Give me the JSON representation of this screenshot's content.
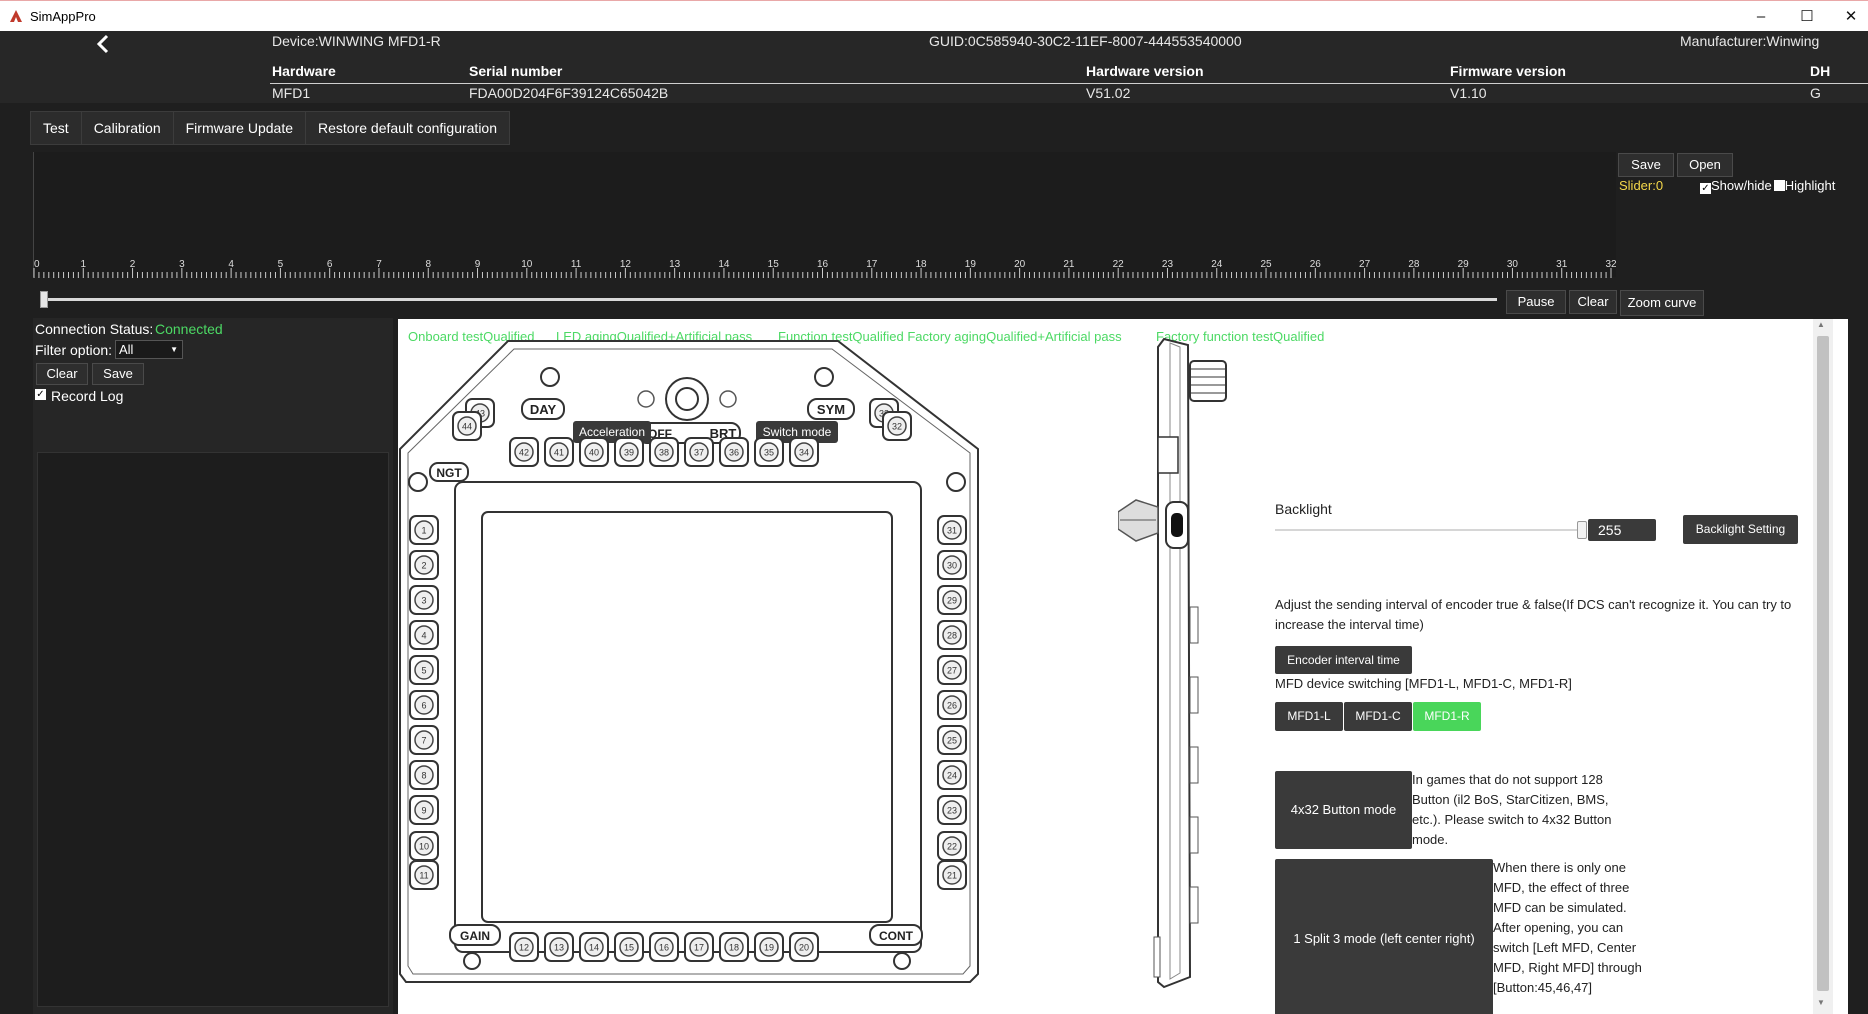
{
  "window": {
    "title": "SimAppPro",
    "minimize": "–",
    "maximize": "☐",
    "close": "✕"
  },
  "header": {
    "device": "Device:WINWING MFD1-R",
    "guid": "GUID:0C585940-30C2-11EF-8007-444553540000",
    "manufacturer": "Manufacturer:Winwing",
    "columns": [
      "Hardware",
      "Serial number",
      "Hardware version",
      "Firmware version",
      "DH"
    ],
    "values": [
      "MFD1",
      "FDA00D204F6F39124C65042B",
      "V51.02",
      "V1.10",
      "G"
    ]
  },
  "tabs": [
    "Test",
    "Calibration",
    "Firmware Update",
    "Restore default configuration"
  ],
  "curve": {
    "save": "Save",
    "open": "Open",
    "slider_label": "Slider:0",
    "show_hide": "Show/hide",
    "highlight": "Highlight",
    "ticks": [
      "0",
      "1",
      "2",
      "3",
      "4",
      "5",
      "6",
      "7",
      "8",
      "9",
      "10",
      "11",
      "12",
      "13",
      "14",
      "15",
      "16",
      "17",
      "18",
      "19",
      "20",
      "21",
      "22",
      "23",
      "24",
      "25",
      "26",
      "27",
      "28",
      "29",
      "30",
      "31",
      "32"
    ],
    "pause": "Pause",
    "clear": "Clear",
    "zoom": "Zoom curve",
    "slider_value": 0
  },
  "left": {
    "connection_label": "Connection Status:",
    "connection_value": "Connected",
    "filter_label": "Filter option:",
    "filter_value": "All",
    "clear": "Clear",
    "save": "Save",
    "record_log": "Record Log"
  },
  "status": [
    "Onboard testQualified",
    "LED agingQualified+Artificial pass",
    "Function testQualified Factory agingQualified+Artificial pass",
    "Factory function testQualified"
  ],
  "device_labels": {
    "day": "DAY",
    "ngt": "NGT",
    "sym": "SYM",
    "con": "CONT",
    "gain": "GAIN",
    "brt": "BRT",
    "off": "OFF",
    "acceleration": "Acceleration",
    "switch_mode": "Switch mode",
    "left_buttons": [
      "1",
      "2",
      "3",
      "4",
      "5",
      "6",
      "7",
      "8",
      "9",
      "10",
      "11"
    ],
    "right_buttons": [
      "31",
      "30",
      "29",
      "28",
      "27",
      "26",
      "25",
      "24",
      "23",
      "22",
      "21"
    ],
    "top_buttons": [
      "42",
      "41",
      "40",
      "39",
      "38",
      "37",
      "36",
      "35",
      "34"
    ],
    "bottom_buttons": [
      "12",
      "13",
      "14",
      "15",
      "16",
      "17",
      "18",
      "19",
      "20"
    ],
    "corner_tl": [
      "43",
      "44"
    ],
    "corner_tr": [
      "33",
      "32"
    ]
  },
  "settings": {
    "backlight_label": "Backlight",
    "backlight_value": "255",
    "backlight_level": 255,
    "backlight_button": "Backlight Setting",
    "encoder_text": "Adjust the sending interval of encoder true & false(If DCS can't recognize it. You can try to increase the interval time)",
    "encoder_button": "Encoder interval time",
    "mfd_switch_text": "MFD device switching [MFD1-L, MFD1-C, MFD1-R]",
    "mfd_buttons": [
      "MFD1-L",
      "MFD1-C",
      "MFD1-R"
    ],
    "mode4x32_button": "4x32 Button mode",
    "mode4x32_text": "In games that do not support 128 Button (il2 BoS, StarCitizen, BMS, etc.). Please switch to 4x32 Button mode.",
    "split_button": "1 Split 3 mode (left center right)",
    "split_text": "When there is only one MFD, the effect of three MFD can be simulated. After opening, you can switch [Left MFD, Center MFD, Right MFD] through [Button:45,46,47]"
  },
  "colors": {
    "connected": "#4cd964",
    "active_mfd": "#49d65a",
    "slider_label": "#f5d84a"
  }
}
